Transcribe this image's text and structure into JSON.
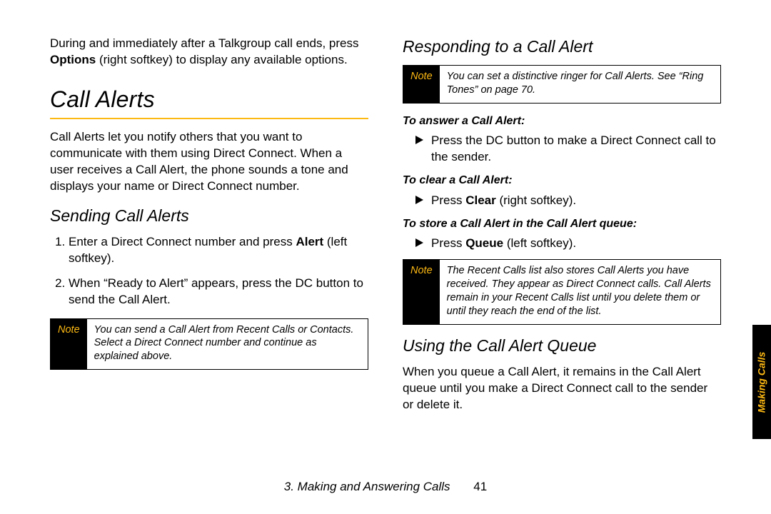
{
  "left": {
    "intro_a": "During and immediately after a Talkgroup call ends, press ",
    "intro_bold": "Options",
    "intro_b": " (right softkey) to display any available options.",
    "h1": "Call Alerts",
    "p1": "Call Alerts let you notify others that you want to communicate with them using Direct Connect. When a user receives a Call Alert, the phone sounds a tone and displays your name or Direct Connect number.",
    "h2": "Sending Call Alerts",
    "step1_a": "Enter a Direct Connect number and press ",
    "step1_bold": "Alert",
    "step1_b": " (left softkey).",
    "step2": "When “Ready to Alert” appears, press the DC button to send the Call Alert.",
    "note_label": "Note",
    "note_text": "You can send a Call Alert from Recent Calls or Contacts. Select a Direct Connect number and continue as explained above."
  },
  "right": {
    "h2a": "Responding to a Call Alert",
    "note1_label": "Note",
    "note1_text": "You can set a distinctive ringer for Call Alerts. See “Ring Tones” on page 70.",
    "instr1": "To answer a Call Alert:",
    "bullet1": "Press the DC button to make a Direct Connect call to the sender.",
    "instr2": "To clear a Call Alert:",
    "bullet2_a": "Press ",
    "bullet2_bold": "Clear",
    "bullet2_b": " (right softkey).",
    "instr3": "To store a Call Alert in the Call Alert queue:",
    "bullet3_a": "Press ",
    "bullet3_bold": "Queue",
    "bullet3_b": " (left softkey).",
    "note2_label": "Note",
    "note2_text": "The Recent Calls list also stores Call Alerts you have received. They appear as Direct Connect calls. Call Alerts remain in your Recent Calls list until you delete them or until they reach the end of the list.",
    "h2b": "Using the Call Alert Queue",
    "p2": "When you queue a Call Alert, it remains in the Call Alert queue until you make a Direct Connect call to the sender or delete it."
  },
  "sideTab": "Making Calls",
  "footer_chapter": "3. Making and Answering Calls",
  "footer_page": "41"
}
